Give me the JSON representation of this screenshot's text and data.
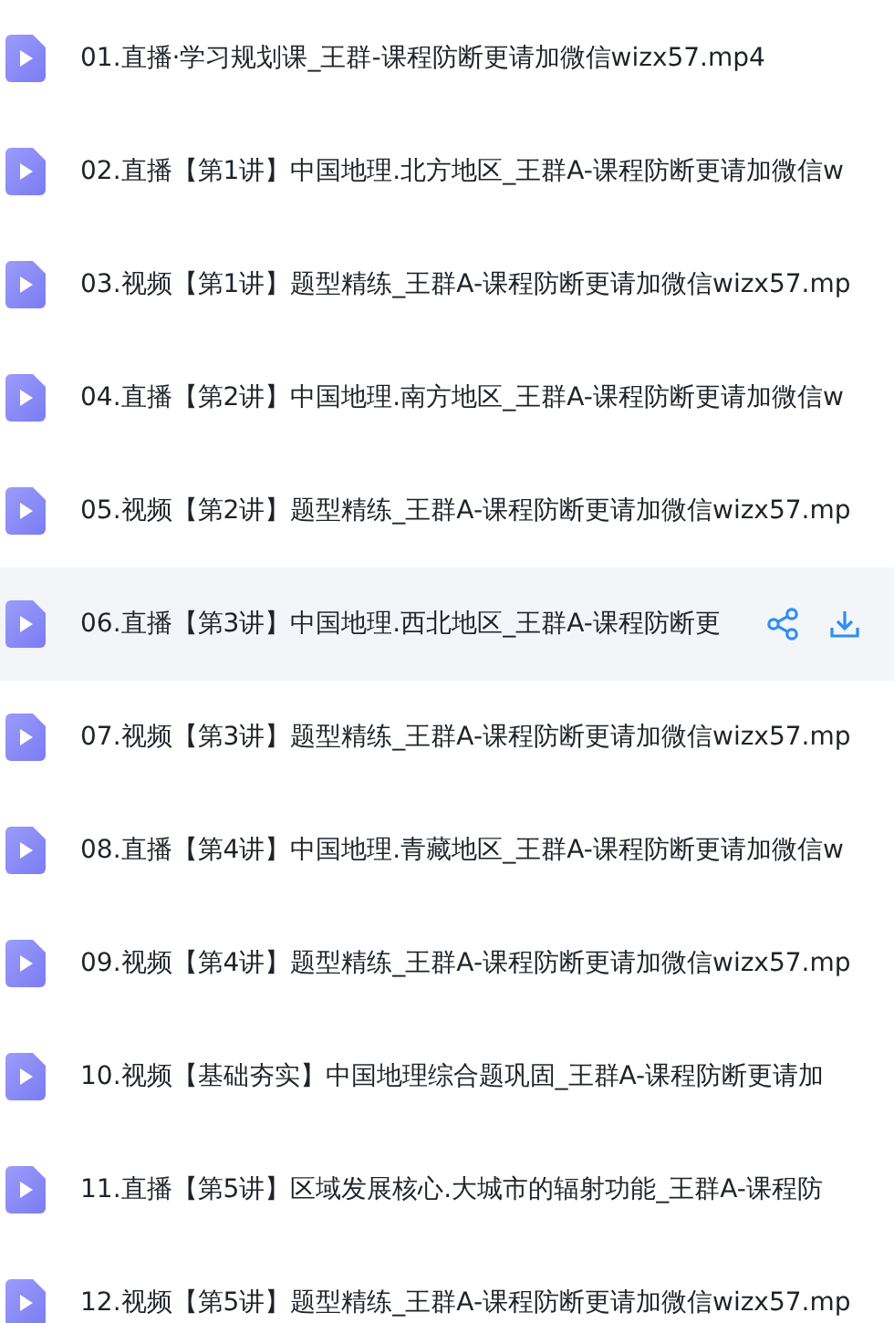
{
  "files": [
    {
      "name": "01.直播·学习规划课_王群-课程防断更请加微信wizx57.mp4",
      "selected": false
    },
    {
      "name": "02.直播【第1讲】中国地理.北方地区_王群A-课程防断更请加微信w",
      "selected": false
    },
    {
      "name": "03.视频【第1讲】题型精练_王群A-课程防断更请加微信wizx57.mp",
      "selected": false
    },
    {
      "name": "04.直播【第2讲】中国地理.南方地区_王群A-课程防断更请加微信w",
      "selected": false
    },
    {
      "name": "05.视频【第2讲】题型精练_王群A-课程防断更请加微信wizx57.mp",
      "selected": false
    },
    {
      "name": "06.直播【第3讲】中国地理.西北地区_王群A-课程防断更",
      "selected": true
    },
    {
      "name": "07.视频【第3讲】题型精练_王群A-课程防断更请加微信wizx57.mp",
      "selected": false
    },
    {
      "name": "08.直播【第4讲】中国地理.青藏地区_王群A-课程防断更请加微信w",
      "selected": false
    },
    {
      "name": "09.视频【第4讲】题型精练_王群A-课程防断更请加微信wizx57.mp",
      "selected": false
    },
    {
      "name": "10.视频【基础夯实】中国地理综合题巩固_王群A-课程防断更请加",
      "selected": false
    },
    {
      "name": "11.直播【第5讲】区域发展核心.大城市的辐射功能_王群A-课程防",
      "selected": false
    },
    {
      "name": "12.视频【第5讲】题型精练_王群A-课程防断更请加微信wizx57.mp",
      "selected": false
    }
  ]
}
